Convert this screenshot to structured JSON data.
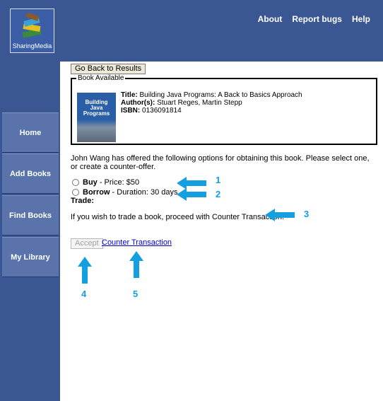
{
  "header": {
    "logo_text": "SharingMedia",
    "nav": [
      "About",
      "Report bugs",
      "Help"
    ]
  },
  "sidebar": {
    "items": [
      {
        "label": "Home"
      },
      {
        "label": "Add Books"
      },
      {
        "label": "Find Books"
      },
      {
        "label": "My Library"
      }
    ]
  },
  "main": {
    "back_button": "Go Back to Results",
    "book_legend": "Book Available",
    "book": {
      "title_label": "Title:",
      "title": "Building Java Programs: A Back to Basics Approach",
      "author_label": "Author(s):",
      "authors": "Stuart Reges, Martin Stepp",
      "isbn_label": "ISBN:",
      "isbn": "0136091814",
      "cover_text": "Building Java Programs"
    },
    "offer_text": "John Wang has offered the following options for obtaining this book. Please select one, or create a counter-offer.",
    "options": [
      {
        "name": "Buy",
        "detail": " - Price: $50"
      },
      {
        "name": "Borrow",
        "detail": " - Duration: 30 days"
      }
    ],
    "trade_label": "Trade:",
    "trade_info": "If you wish to trade a book, proceed with Counter Transaction.",
    "accept_button": "Accept",
    "counter_link": "Counter Transaction"
  },
  "annotations": {
    "color": "#14a0e0",
    "labels": [
      "1",
      "2",
      "3",
      "4",
      "5"
    ]
  }
}
